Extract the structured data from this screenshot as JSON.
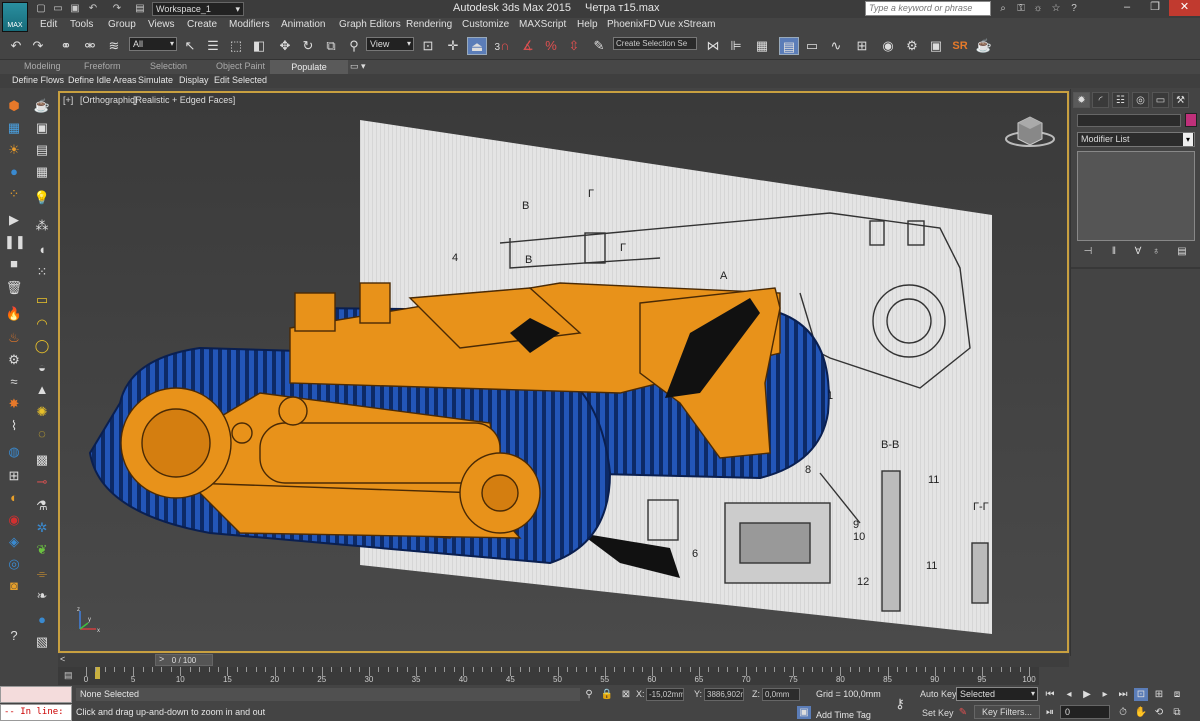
{
  "titlebar": {
    "app_title": "Autodesk 3ds Max  2015",
    "file_title": "Четра т15.max",
    "workspace": "Workspace_1",
    "search_placeholder": "Type a keyword or phrase",
    "app_logo": "MAX",
    "icons": [
      "new-file-icon",
      "open-file-icon",
      "save-file-icon",
      "undo-icon",
      "redo-icon",
      "project-folder-icon",
      "search-icon",
      "subscription-icon",
      "communication-center-icon",
      "favorites-icon",
      "help-icon"
    ]
  },
  "menu": [
    "Edit",
    "Tools",
    "Group",
    "Views",
    "Create",
    "Modifiers",
    "Animation",
    "Graph Editors",
    "Rendering",
    "Customize",
    "MAXScript",
    "Help",
    "PhoenixFD",
    "Vue xStream"
  ],
  "main_toolbar": {
    "selection_filter": "All",
    "reference_coord": "View",
    "named_selection_set": "Create Selection Se",
    "snap_label": "3",
    "icons": [
      "undo-icon",
      "redo-icon",
      "link-icon",
      "unlink-icon",
      "bind-space-warp-icon",
      "select-object-icon",
      "select-by-name-icon",
      "rectangular-selection-icon",
      "window-crossing-icon",
      "select-move-icon",
      "select-rotate-icon",
      "select-scale-icon",
      "select-place-icon",
      "use-pivot-icon",
      "select-manipulate-icon",
      "keyboard-shortcut-icon",
      "snaps-toggle-icon",
      "angle-snap-icon",
      "percent-snap-icon",
      "spinner-snap-icon",
      "edit-named-selection-icon",
      "mirror-icon",
      "align-icon",
      "toggle-scene-explorer-icon",
      "toggle-layer-explorer-icon",
      "toggle-ribbon-icon",
      "curve-editor-icon",
      "schematic-view-icon",
      "material-editor-icon",
      "render-setup-icon",
      "rendered-frame-window-icon",
      "render-production-icon",
      "sr-plugin-icon",
      "teapot-render-icon"
    ]
  },
  "ribbon": {
    "tabs": [
      "Modeling",
      "Freeform",
      "Selection",
      "Object Paint",
      "Populate"
    ],
    "active_tab": "Populate",
    "options": "▭ ▾",
    "populate_items": [
      "Define Flows",
      "Define Idle Areas",
      "Simulate",
      "Display",
      "Edit Selected"
    ]
  },
  "viewport": {
    "label_plus": "[+]",
    "label_view": "[Orthographic]",
    "label_shading": "[Realistic + Edged Faces]",
    "viewcube_icon": "viewcube-icon",
    "axis_labels": [
      "x",
      "y",
      "z"
    ],
    "drawing_labels": [
      "B",
      "Г",
      "4",
      "A",
      "1",
      "B",
      "B-B",
      "11",
      "Г-Г",
      "8",
      "9",
      "10",
      "6",
      "12",
      "11",
      "Г"
    ]
  },
  "command_panel": {
    "tabs": [
      "create-tab-icon",
      "modify-tab-icon",
      "hierarchy-tab-icon",
      "motion-tab-icon",
      "display-tab-icon",
      "utilities-tab-icon"
    ],
    "object_name": "",
    "object_color": "#c0307a",
    "modifier_list": "Modifier List",
    "stack_icons": [
      "pin-stack-icon",
      "show-end-result-icon",
      "make-unique-icon",
      "remove-modifier-icon",
      "configure-modifier-sets-icon"
    ]
  },
  "timeline": {
    "frame_label": "0 / 100",
    "prev": "<",
    "next": ">",
    "ticks": [
      "0",
      "5",
      "10",
      "15",
      "20",
      "25",
      "30",
      "35",
      "40",
      "45",
      "50",
      "55",
      "60",
      "65",
      "70",
      "75",
      "80",
      "85",
      "90",
      "95",
      "100"
    ]
  },
  "statusbar": {
    "maxscript_prompt": "-- In line:",
    "selection_status": "None Selected",
    "prompt": "Click and drag up-and-down to zoom in and out",
    "x_label": "X:",
    "x_value": "-15,02mm",
    "y_label": "Y:",
    "y_value": "3886,902m",
    "z_label": "Z:",
    "z_value": "0,0mm",
    "grid": "Grid = 100,0mm",
    "add_time_tag": "Add Time Tag",
    "auto_key": "Auto Key",
    "set_key": "Set Key",
    "key_mode": "Selected",
    "key_filters": "Key Filters...",
    "current_frame": "0"
  },
  "colors": {
    "accent": "#c8a040",
    "active_button": "#5b7db8",
    "chassis": "#e8921a",
    "tracks": "#1e4fa8",
    "close_button": "#c13a2f"
  }
}
